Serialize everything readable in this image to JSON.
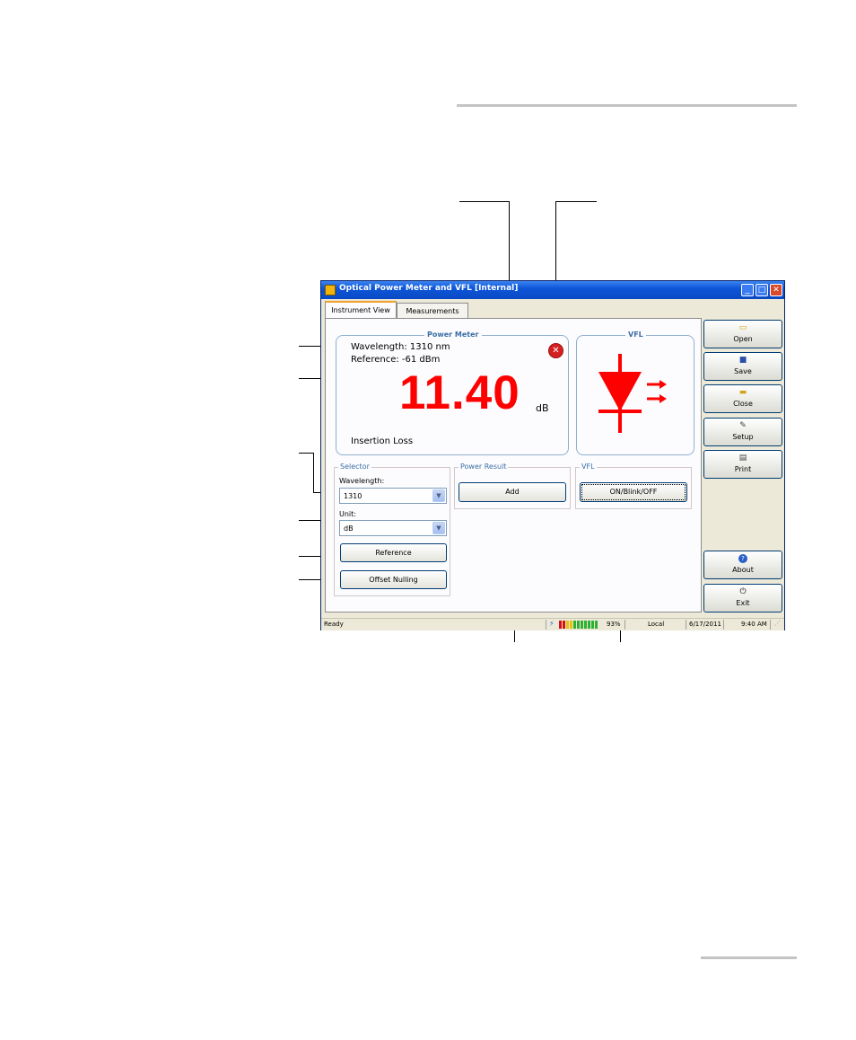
{
  "window": {
    "title": "Optical Power Meter and VFL [Internal]",
    "minimize": "_",
    "maximize": "□",
    "close": "✕"
  },
  "tabs": [
    {
      "label": "Instrument View",
      "active": true
    },
    {
      "label": "Measurements",
      "active": false
    }
  ],
  "power_meter": {
    "legend": "Power Meter",
    "wavelength_text": "Wavelength: 1310 nm",
    "reference_text": "Reference: -61 dBm",
    "reading": "11.40",
    "unit": "dB",
    "mode": "Insertion Loss",
    "reading_color": "#ff0000"
  },
  "vfl_display": {
    "legend": "VFL",
    "icon": "laser-diode-icon",
    "color": "#ff0000"
  },
  "selector": {
    "legend": "Selector",
    "wavelength_label": "Wavelength:",
    "wavelength_value": "1310",
    "unit_label": "Unit:",
    "unit_value": "dB",
    "reference_button": "Reference",
    "offset_button": "Offset Nulling"
  },
  "power_result": {
    "legend": "Power Result",
    "add_button": "Add"
  },
  "vfl_control": {
    "legend": "VFL",
    "toggle_button": "ON/Blink/OFF"
  },
  "sidebar": {
    "items": [
      {
        "label": "Open",
        "icon": "open-folder-icon"
      },
      {
        "label": "Save",
        "icon": "save-disk-icon"
      },
      {
        "label": "Close",
        "icon": "close-folder-icon"
      },
      {
        "label": "Setup",
        "icon": "setup-edit-icon"
      },
      {
        "label": "Print",
        "icon": "printer-icon"
      },
      {
        "label": "About",
        "icon": "about-help-icon"
      },
      {
        "label": "Exit",
        "icon": "power-icon"
      }
    ]
  },
  "statusbar": {
    "status": "Ready",
    "battery_percent": "93%",
    "battery_level": 0.93,
    "mode": "Local",
    "date": "6/17/2011",
    "time": "9:40 AM"
  }
}
